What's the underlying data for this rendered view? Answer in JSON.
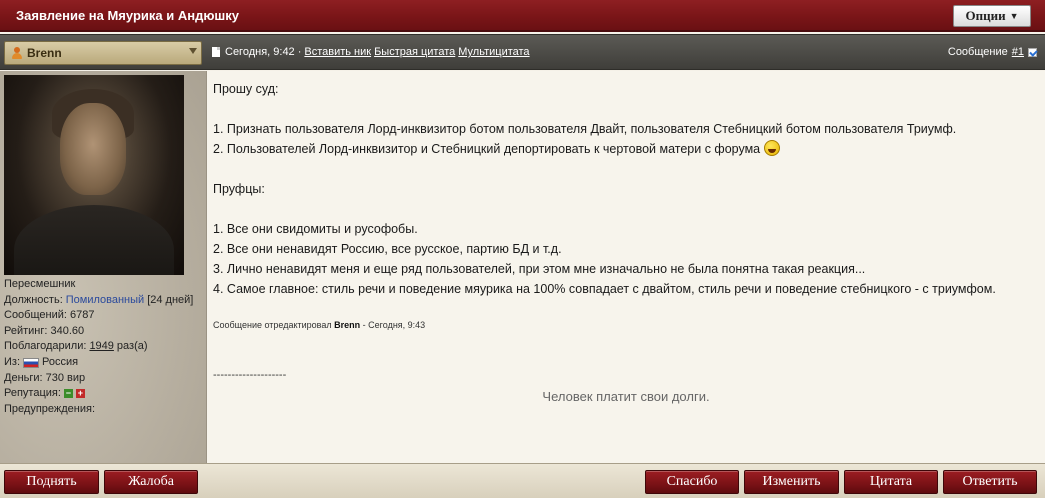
{
  "topic": {
    "title": "Заявление на Мяурика и Андюшку",
    "options_label": "Опции"
  },
  "meta": {
    "author": "Brenn",
    "date": "Сегодня, 9:42",
    "sep": "·",
    "insert_nick": "Вставить ник",
    "quick_quote": "Быстрая цитата",
    "multi_quote": "Мультицитата",
    "message_label": "Сообщение",
    "message_number": "#1"
  },
  "profile": {
    "title": "Пересмешник",
    "position_label": "Должность:",
    "position_value": "Помилованный",
    "position_days": "[24 дней]",
    "posts": "Сообщений: 6787",
    "rating": "Рейтинг: 340.60",
    "thanked_label": "Поблагодарили:",
    "thanked_count": "1949",
    "thanked_suffix": "раз(а)",
    "from_label": "Из:",
    "from_value": "Россия",
    "money": "Деньги: 730 вир",
    "reputation_label": "Репутация:",
    "warnings_label": "Предупреждения:"
  },
  "post": {
    "lines": [
      "Прошу суд:",
      "",
      "1. Признать пользователя Лорд-инквизитор ботом пользователя Двайт, пользователя Стебницкий ботом пользователя Триумф.",
      "2. Пользователей Лорд-инквизитор и Стебницкий депортировать к чертовой матери с форума",
      "",
      "Пруфцы:",
      "",
      "1. Все они свидомиты и русофобы.",
      "2. Все они ненавидят Россию, все русское, партию БД и т.д.",
      "3. Лично ненавидят меня и еще ряд пользователей, при этом мне изначально не была понятна такая реакция...",
      "4. Самое главное: стиль речи и поведение мяурика на 100% совпадает с двайтом, стиль речи и поведение стебницкого - с триумфом."
    ],
    "edited_prefix": "Сообщение отредактировал",
    "edited_by": "Brenn",
    "edited_suffix": "- Сегодня, 9:43",
    "signature_sep": "--------------------",
    "signature": "Человек платит свои долги."
  },
  "actions": {
    "up": "Поднять",
    "complain": "Жалоба",
    "thanks": "Спасибо",
    "edit": "Изменить",
    "quote": "Цитата",
    "reply": "Ответить"
  },
  "colors": {
    "title_red": "#7a1518",
    "button_red": "#7a1216",
    "body_bg": "#f7f4ec",
    "meta_bg": "#4a4944"
  }
}
